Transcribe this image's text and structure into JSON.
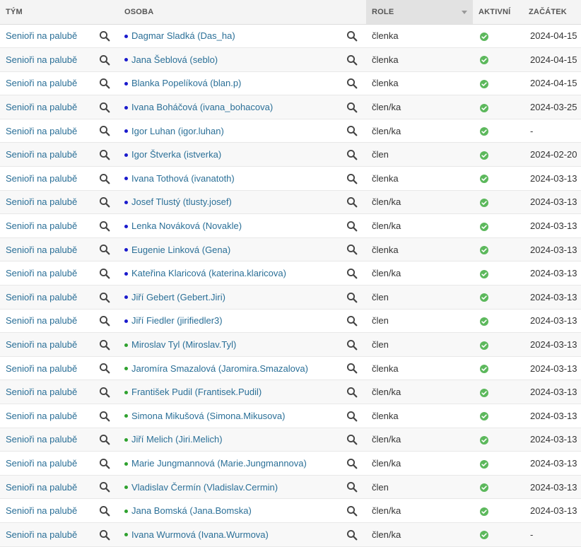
{
  "headers": {
    "team": "TÝM",
    "person": "OSOBA",
    "role": "ROLE",
    "active": "AKTIVNÍ",
    "start": "ZAČÁTEK"
  },
  "colors": {
    "link": "#2a6f97",
    "dot_blue": "#1a1acc",
    "dot_green": "#2ea12e",
    "check": "#5cb85c"
  },
  "rows": [
    {
      "team": "Senioři na palubě",
      "person": "Dagmar Sladká (Das_ha)",
      "dot": "blue",
      "role": "členka",
      "active_icon": "check-circle-icon",
      "start": "2024-04-15"
    },
    {
      "team": "Senioři na palubě",
      "person": "Jana Šeblová (seblo)",
      "dot": "blue",
      "role": "členka",
      "active_icon": "check-circle-icon",
      "start": "2024-04-15"
    },
    {
      "team": "Senioři na palubě",
      "person": "Blanka Popelíková (blan.p)",
      "dot": "blue",
      "role": "členka",
      "active_icon": "check-circle-icon",
      "start": "2024-04-15"
    },
    {
      "team": "Senioři na palubě",
      "person": "Ivana Boháčová (ivana_bohacova)",
      "dot": "blue",
      "role": "člen/ka",
      "active_icon": "check-circle-icon",
      "start": "2024-03-25"
    },
    {
      "team": "Senioři na palubě",
      "person": "Igor Luhan (igor.luhan)",
      "dot": "blue",
      "role": "člen/ka",
      "active_icon": "check-circle-icon",
      "start": "-"
    },
    {
      "team": "Senioři na palubě",
      "person": "Igor Štverka (istverka)",
      "dot": "blue",
      "role": "člen",
      "active_icon": "check-circle-icon",
      "start": "2024-02-20"
    },
    {
      "team": "Senioři na palubě",
      "person": "Ivana Tothová (ivanatoth)",
      "dot": "blue",
      "role": "členka",
      "active_icon": "check-circle-icon",
      "start": "2024-03-13"
    },
    {
      "team": "Senioři na palubě",
      "person": "Josef Tlustý (tlusty.josef)",
      "dot": "blue",
      "role": "člen/ka",
      "active_icon": "check-circle-icon",
      "start": "2024-03-13"
    },
    {
      "team": "Senioři na palubě",
      "person": "Lenka Nováková (Novakle)",
      "dot": "blue",
      "role": "člen/ka",
      "active_icon": "check-circle-icon",
      "start": "2024-03-13"
    },
    {
      "team": "Senioři na palubě",
      "person": "Eugenie Linková (Gena)",
      "dot": "blue",
      "role": "členka",
      "active_icon": "check-circle-icon",
      "start": "2024-03-13"
    },
    {
      "team": "Senioři na palubě",
      "person": "Kateřina Klaricová (katerina.klaricova)",
      "dot": "blue",
      "role": "člen/ka",
      "active_icon": "check-circle-icon",
      "start": "2024-03-13"
    },
    {
      "team": "Senioři na palubě",
      "person": "Jiří Gebert (Gebert.Jiri)",
      "dot": "blue",
      "role": "člen",
      "active_icon": "check-circle-icon",
      "start": "2024-03-13"
    },
    {
      "team": "Senioři na palubě",
      "person": "Jiří Fiedler (jirifiedler3)",
      "dot": "blue",
      "role": "člen",
      "active_icon": "check-circle-icon",
      "start": "2024-03-13"
    },
    {
      "team": "Senioři na palubě",
      "person": "Miroslav Tyl (Miroslav.Tyl)",
      "dot": "green",
      "role": "člen",
      "active_icon": "check-circle-icon",
      "start": "2024-03-13"
    },
    {
      "team": "Senioři na palubě",
      "person": "Jaromíra Smazalová (Jaromira.Smazalova)",
      "dot": "green",
      "role": "členka",
      "active_icon": "check-circle-icon",
      "start": "2024-03-13"
    },
    {
      "team": "Senioři na palubě",
      "person": "František Pudil (Frantisek.Pudil)",
      "dot": "green",
      "role": "člen/ka",
      "active_icon": "check-circle-icon",
      "start": "2024-03-13"
    },
    {
      "team": "Senioři na palubě",
      "person": "Simona Mikušová (Simona.Mikusova)",
      "dot": "green",
      "role": "členka",
      "active_icon": "check-circle-icon",
      "start": "2024-03-13"
    },
    {
      "team": "Senioři na palubě",
      "person": "Jiří Melich (Jiri.Melich)",
      "dot": "green",
      "role": "člen/ka",
      "active_icon": "check-circle-icon",
      "start": "2024-03-13"
    },
    {
      "team": "Senioři na palubě",
      "person": "Marie Jungmannová (Marie.Jungmannova)",
      "dot": "green",
      "role": "člen/ka",
      "active_icon": "check-circle-icon",
      "start": "2024-03-13"
    },
    {
      "team": "Senioři na palubě",
      "person": "Vladislav Čermín (Vladislav.Cermin)",
      "dot": "green",
      "role": "člen",
      "active_icon": "check-circle-icon",
      "start": "2024-03-13"
    },
    {
      "team": "Senioři na palubě",
      "person": "Jana Bomská (Jana.Bomska)",
      "dot": "green",
      "role": "člen/ka",
      "active_icon": "check-circle-icon",
      "start": "2024-03-13"
    },
    {
      "team": "Senioři na palubě",
      "person": "Ivana Wurmová (Ivana.Wurmova)",
      "dot": "green",
      "role": "člen/ka",
      "active_icon": "check-circle-icon",
      "start": "-"
    }
  ]
}
